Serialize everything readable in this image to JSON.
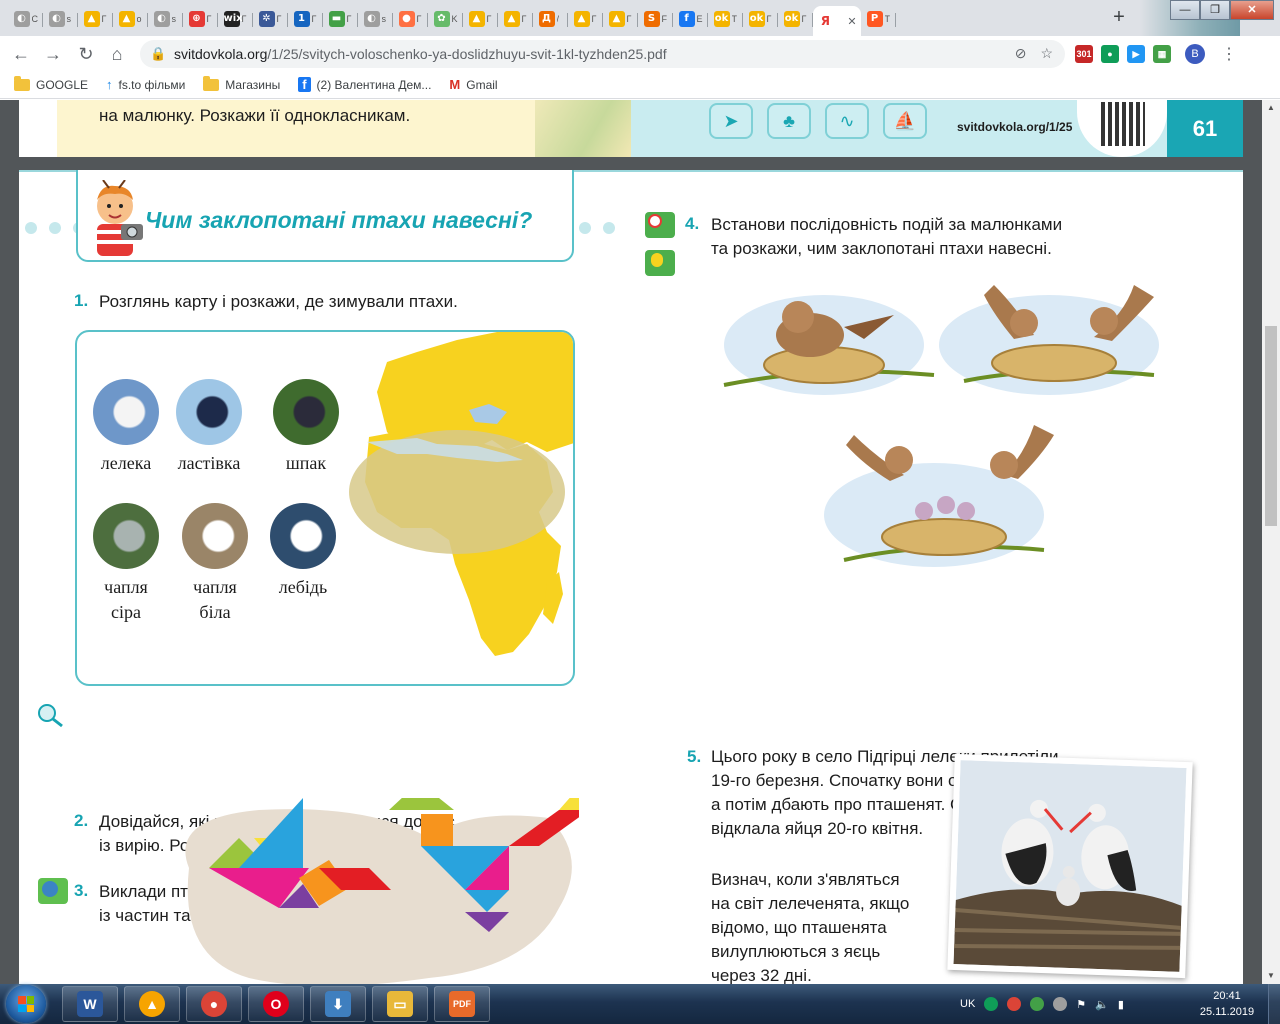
{
  "browser": {
    "tabs": [
      {
        "icon": "chrome-icon",
        "color": "#9e9e9e",
        "glyph": "◐",
        "title": "С"
      },
      {
        "icon": "chrome-icon",
        "color": "#9e9e9e",
        "glyph": "◐",
        "title": "s"
      },
      {
        "icon": "bell-icon",
        "color": "#f4b400",
        "glyph": "▲",
        "title": "Г"
      },
      {
        "icon": "bell-icon",
        "color": "#f4b400",
        "glyph": "▲",
        "title": "o"
      },
      {
        "icon": "chrome-icon",
        "color": "#9e9e9e",
        "glyph": "◐",
        "title": "s"
      },
      {
        "icon": "globe-icon",
        "color": "#e53935",
        "glyph": "⊕",
        "title": "Г"
      },
      {
        "icon": "wix-icon",
        "color": "#222222",
        "glyph": "wix",
        "title": "Г"
      },
      {
        "icon": "gear-icon",
        "color": "#3b5998",
        "glyph": "✲",
        "title": "Г"
      },
      {
        "icon": "one-icon",
        "color": "#1565c0",
        "glyph": "1",
        "title": "Г"
      },
      {
        "icon": "map-icon",
        "color": "#43a047",
        "glyph": "▬",
        "title": "Г"
      },
      {
        "icon": "chrome-icon",
        "color": "#9e9e9e",
        "glyph": "◐",
        "title": "s"
      },
      {
        "icon": "ball-icon",
        "color": "#ff7043",
        "glyph": "●",
        "title": "Г"
      },
      {
        "icon": "leaf-icon",
        "color": "#66bb6a",
        "glyph": "✿",
        "title": "K"
      },
      {
        "icon": "bell-icon",
        "color": "#f4b400",
        "glyph": "▲",
        "title": "Г"
      },
      {
        "icon": "bell-icon",
        "color": "#f4b400",
        "glyph": "▲",
        "title": "Г"
      },
      {
        "icon": "d-icon",
        "color": "#ef6c00",
        "glyph": "Д",
        "title": "/"
      },
      {
        "icon": "bell-icon",
        "color": "#f4b400",
        "glyph": "▲",
        "title": "Г"
      },
      {
        "icon": "bell-icon",
        "color": "#f4b400",
        "glyph": "▲",
        "title": "Г"
      },
      {
        "icon": "s-icon",
        "color": "#ef6c00",
        "glyph": "S",
        "title": "F"
      },
      {
        "icon": "facebook-icon",
        "color": "#1877f2",
        "glyph": "f",
        "title": "Е"
      },
      {
        "icon": "ok-icon",
        "color": "#f4b400",
        "glyph": "ok",
        "title": "Т"
      },
      {
        "icon": "ok-icon",
        "color": "#f4b400",
        "glyph": "ok",
        "title": "Г"
      },
      {
        "icon": "ok-icon",
        "color": "#f4b400",
        "glyph": "ok",
        "title": "Г"
      },
      {
        "icon": "yandex-icon",
        "color": "#ffffff",
        "glyph": "Я",
        "title": "",
        "active": true
      },
      {
        "icon": "p-icon",
        "color": "#ff5722",
        "glyph": "P",
        "title": "Т"
      }
    ],
    "new_tab": "+",
    "window_controls": {
      "minimize": "—",
      "restore": "❐",
      "close": "✕"
    },
    "nav": {
      "back": "←",
      "forward": "→",
      "reload": "↻",
      "home": "⌂"
    },
    "url_host": "svitdovkola.org",
    "url_path": "/1/25/svitych-voloschenko-ya-doslidzhuyu-svit-1kl-tyzhden25.pdf",
    "extensions": [
      {
        "icon": "gmail-counter-icon",
        "color": "#c62828",
        "label": "301"
      },
      {
        "icon": "hangouts-icon",
        "color": "#0f9d58",
        "label": "●"
      },
      {
        "icon": "play-icon",
        "color": "#2196f3",
        "label": "▶"
      },
      {
        "icon": "calendar-icon",
        "color": "#43a047",
        "label": "▦"
      }
    ],
    "profile_initial": "В",
    "menu": "⋮",
    "bookmarks": [
      {
        "type": "folder",
        "label": "GOOGLE"
      },
      {
        "type": "link",
        "icon": "arrow-up-icon",
        "label": "fs.to фільми"
      },
      {
        "type": "folder",
        "label": "Магазины"
      },
      {
        "type": "link",
        "icon": "facebook-icon",
        "label": "(2) Валентина Дем..."
      },
      {
        "type": "link",
        "icon": "gmail-icon",
        "label": "Gmail"
      }
    ]
  },
  "pdf": {
    "top_text": "на малюнку. Розкажи її однокласникам.",
    "top_url": "svitdovkola.org/1/25",
    "page_number": "61",
    "section_title": "Чим заклопотані птахи навесні?",
    "task1": {
      "num": "1.",
      "text": "Розглянь карту і розкажи, де зимували птахи."
    },
    "birds": [
      {
        "name": "лелека",
        "line2": ""
      },
      {
        "name": "ластівка",
        "line2": ""
      },
      {
        "name": "шпак",
        "line2": ""
      },
      {
        "name": "чапля",
        "line2": "сіра"
      },
      {
        "name": "чапля",
        "line2": "біла"
      },
      {
        "name": "лебідь",
        "line2": ""
      }
    ],
    "task2": {
      "num": "2.",
      "line1": "Довідайся, які птахи вже повернулися до нас",
      "line2": "із вирію. Розкажи про їхню поведінку навесні."
    },
    "task3": {
      "num": "3.",
      "line1": "Виклади пташок",
      "line2": "із частин танграма."
    },
    "task4": {
      "num": "4.",
      "line1": "Встанови послідовність подій за малюнками",
      "line2": "та розкажи, чим заклопотані птахи навесні."
    },
    "task5": {
      "num": "5.",
      "lines": [
        "Цього року в село Підгірці лелеки прилетіли",
        "19-го березня. Спочатку вони облаштовують гніздо,",
        "а потім дбають про пташенят. Самичка-лелека",
        "відклала яйця 20-го квітня."
      ],
      "question": [
        "Визнач, коли з'являться",
        "на світ лелеченята, якщо",
        "відомо, що пташенята",
        "вилуплюються з яєць",
        "через 32 дні."
      ]
    }
  },
  "taskbar": {
    "apps": [
      {
        "icon": "word-icon",
        "color": "#2b579a",
        "label": "W"
      },
      {
        "icon": "avast-icon",
        "color": "#f7a400",
        "label": "▲"
      },
      {
        "icon": "chrome-icon",
        "color": "#db4437",
        "label": "●"
      },
      {
        "icon": "opera-icon",
        "color": "#e0001b",
        "label": "O"
      },
      {
        "icon": "download-icon",
        "color": "#3f7fbf",
        "label": "⬇"
      },
      {
        "icon": "explorer-icon",
        "color": "#e8b83a",
        "label": "▭"
      },
      {
        "icon": "pdf-icon",
        "color": "#e86a2a",
        "label": "PDF"
      }
    ],
    "language": "UK",
    "time": "20:41",
    "date": "25.11.2019"
  }
}
